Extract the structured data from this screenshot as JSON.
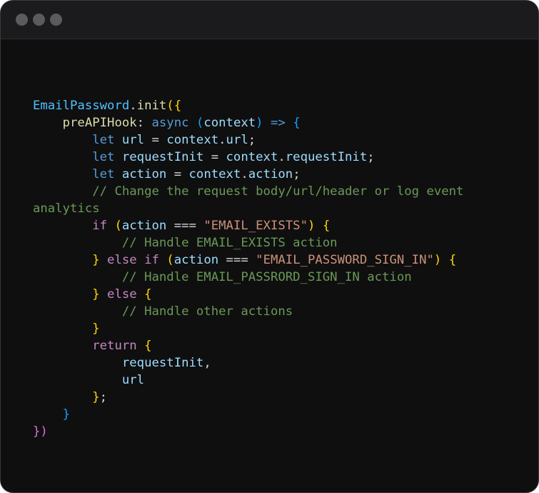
{
  "window": {
    "controls": [
      "window-dot",
      "window-dot",
      "window-dot"
    ]
  },
  "code": {
    "lines": [
      [
        [
          "ident2",
          "EmailPassword"
        ],
        [
          "plain",
          "."
        ],
        [
          "fn",
          "init"
        ],
        [
          "b1",
          "({"
        ]
      ],
      [
        [
          "plain",
          "    "
        ],
        [
          "fn",
          "preAPIHook"
        ],
        [
          "plain",
          ": "
        ],
        [
          "kw",
          "async"
        ],
        [
          "plain",
          " "
        ],
        [
          "b3",
          "("
        ],
        [
          "ident",
          "context"
        ],
        [
          "b3",
          ")"
        ],
        [
          "plain",
          " "
        ],
        [
          "kw",
          "=>"
        ],
        [
          "plain",
          " "
        ],
        [
          "b3",
          "{"
        ]
      ],
      [
        [
          "plain",
          "        "
        ],
        [
          "kw",
          "let"
        ],
        [
          "plain",
          " "
        ],
        [
          "ident",
          "url"
        ],
        [
          "plain",
          " = "
        ],
        [
          "ident",
          "context"
        ],
        [
          "plain",
          "."
        ],
        [
          "ident",
          "url"
        ],
        [
          "plain",
          ";"
        ]
      ],
      [
        [
          "plain",
          "        "
        ],
        [
          "kw",
          "let"
        ],
        [
          "plain",
          " "
        ],
        [
          "ident",
          "requestInit"
        ],
        [
          "plain",
          " = "
        ],
        [
          "ident",
          "context"
        ],
        [
          "plain",
          "."
        ],
        [
          "ident",
          "requestInit"
        ],
        [
          "plain",
          ";"
        ]
      ],
      [
        [
          "plain",
          "        "
        ],
        [
          "kw",
          "let"
        ],
        [
          "plain",
          " "
        ],
        [
          "ident",
          "action"
        ],
        [
          "plain",
          " = "
        ],
        [
          "ident",
          "context"
        ],
        [
          "plain",
          "."
        ],
        [
          "ident",
          "action"
        ],
        [
          "plain",
          ";"
        ]
      ],
      [
        [
          "plain",
          "        "
        ],
        [
          "cmt",
          "// Change the request body/url/header or log event"
        ]
      ],
      [
        [
          "cmt",
          "analytics"
        ]
      ],
      [
        [
          "plain",
          "        "
        ],
        [
          "ctrl",
          "if"
        ],
        [
          "plain",
          " "
        ],
        [
          "b1",
          "("
        ],
        [
          "ident",
          "action"
        ],
        [
          "plain",
          " === "
        ],
        [
          "str",
          "\"EMAIL_EXISTS\""
        ],
        [
          "b1",
          ")"
        ],
        [
          "plain",
          " "
        ],
        [
          "b1",
          "{"
        ]
      ],
      [
        [
          "plain",
          "            "
        ],
        [
          "cmt",
          "// Handle EMAIL_EXISTS action"
        ]
      ],
      [
        [
          "plain",
          "        "
        ],
        [
          "b1",
          "}"
        ],
        [
          "plain",
          " "
        ],
        [
          "ctrl",
          "else"
        ],
        [
          "plain",
          " "
        ],
        [
          "ctrl",
          "if"
        ],
        [
          "plain",
          " "
        ],
        [
          "b1",
          "("
        ],
        [
          "ident",
          "action"
        ],
        [
          "plain",
          " === "
        ],
        [
          "str",
          "\"EMAIL_PASSWORD_SIGN_IN\""
        ],
        [
          "b1",
          ")"
        ],
        [
          "plain",
          " "
        ],
        [
          "b1",
          "{"
        ]
      ],
      [
        [
          "plain",
          "            "
        ],
        [
          "cmt",
          "// Handle EMAIL_PASSRORD_SIGN_IN action"
        ]
      ],
      [
        [
          "plain",
          "        "
        ],
        [
          "b1",
          "}"
        ],
        [
          "plain",
          " "
        ],
        [
          "ctrl",
          "else"
        ],
        [
          "plain",
          " "
        ],
        [
          "b1",
          "{"
        ]
      ],
      [
        [
          "plain",
          "            "
        ],
        [
          "cmt",
          "// Handle other actions"
        ]
      ],
      [
        [
          "plain",
          "        "
        ],
        [
          "b1",
          "}"
        ]
      ],
      [
        [
          "plain",
          "        "
        ],
        [
          "ctrl",
          "return"
        ],
        [
          "plain",
          " "
        ],
        [
          "b1",
          "{"
        ]
      ],
      [
        [
          "plain",
          "            "
        ],
        [
          "ident",
          "requestInit"
        ],
        [
          "plain",
          ","
        ]
      ],
      [
        [
          "plain",
          "            "
        ],
        [
          "ident",
          "url"
        ]
      ],
      [
        [
          "plain",
          "        "
        ],
        [
          "b1",
          "}"
        ],
        [
          "plain",
          ";"
        ]
      ],
      [
        [
          "plain",
          "    "
        ],
        [
          "b3",
          "}"
        ]
      ],
      [
        [
          "b2",
          "})"
        ]
      ]
    ]
  }
}
